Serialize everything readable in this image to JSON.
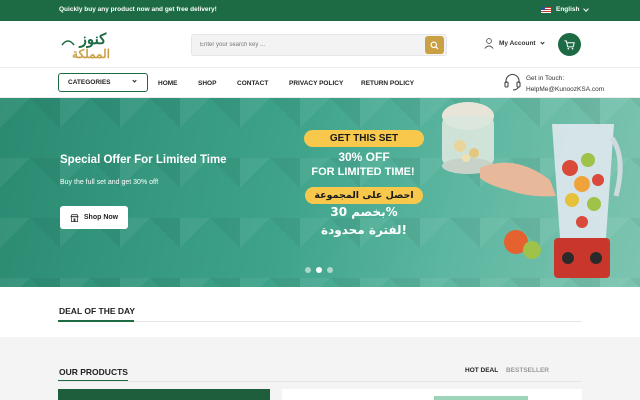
{
  "topbar": {
    "promo_text": "Quickly buy any product now and get free delivery!",
    "language": "English"
  },
  "header": {
    "logo_text": "كنوز المملكة",
    "search": {
      "placeholder": "Enter your search key ...",
      "value": ""
    },
    "account_label": "My Account"
  },
  "nav": {
    "categories_label": "CATEGORIES",
    "links": [
      "HOME",
      "SHOP",
      "CONTACT",
      "PRIVACY POLICY",
      "RETURN POLICY"
    ],
    "contact": {
      "label": "Get in Touch:",
      "email": "HelpMe@KunoozKSA.com"
    }
  },
  "hero": {
    "title": "Special Offer For Limited Time",
    "subtitle": "Buy the full set and get 30% off!",
    "cta_label": "Shop Now",
    "promo": {
      "line1": "GET THIS SET",
      "line2": "30% OFF",
      "line3": "FOR LIMITED TIME!",
      "ar_line1": "احصل على المجموعة",
      "ar_line2": "بخصم 30%",
      "ar_line3": "لفترة محدودة!"
    },
    "slide_count": 3,
    "active_slide": 1
  },
  "deal": {
    "title": "DEAL OF THE DAY"
  },
  "products": {
    "title": "OUR PRODUCTS",
    "tabs": [
      "HOT DEAL",
      "BESTSELLER"
    ],
    "active_tab": "HOT DEAL"
  },
  "colors": {
    "brand_green": "#1d6b44",
    "accent_gold": "#caa045",
    "promo_yellow": "#f7c84b"
  },
  "icons": {
    "search": "search-icon",
    "account": "user-icon",
    "cart": "cart-icon",
    "support": "headset-icon",
    "shop": "store-icon"
  }
}
